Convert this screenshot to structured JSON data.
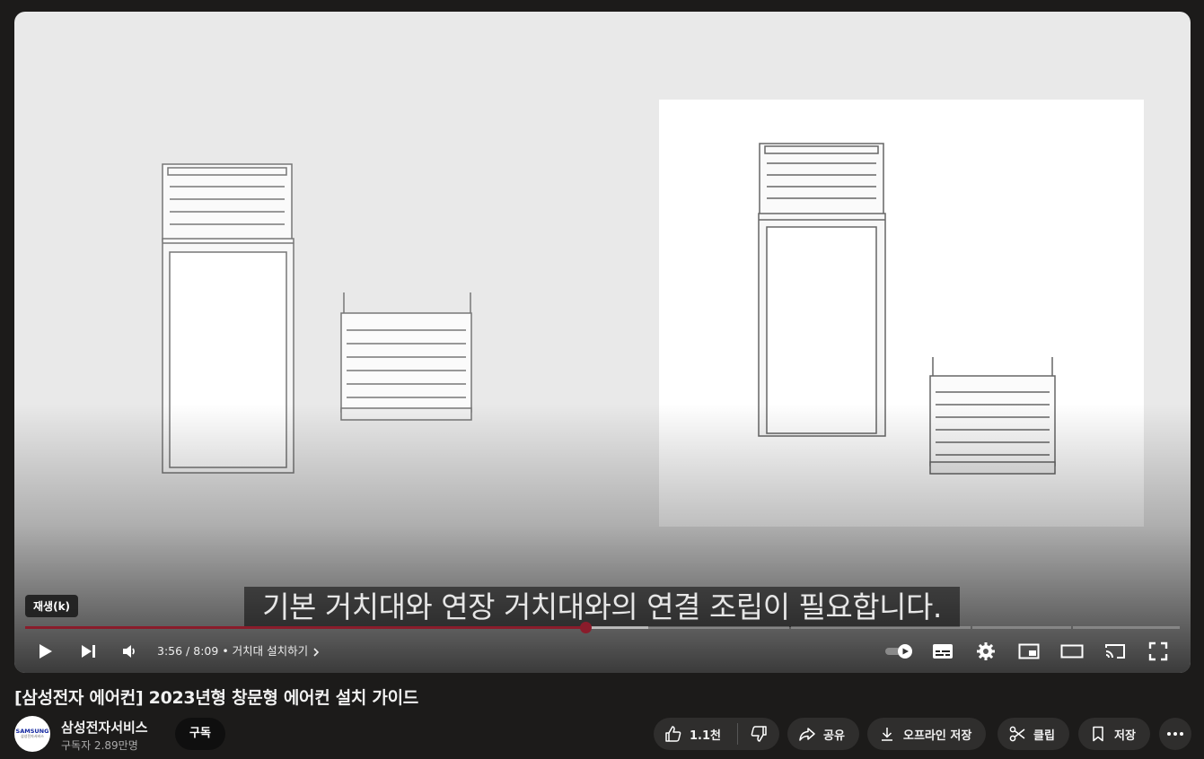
{
  "player": {
    "caption": "기본 거치대와 연장 거치대와의 연결 조립이 필요합니다.",
    "tooltip": "재생(k)",
    "progress": {
      "played_fraction": 0.485,
      "buffered_fraction": 0.54
    },
    "time_current": "3:56",
    "time_separator": " / ",
    "time_total": "8:09",
    "chapter": "• 거치대 설치하기",
    "icons": {
      "play": "play-icon",
      "next": "next-icon",
      "volume": "volume-icon",
      "autoplay": "autoplay-toggle-icon",
      "subtitles": "subtitles-icon",
      "settings": "gear-icon",
      "miniplayer": "miniplayer-icon",
      "theater": "theater-mode-icon",
      "cast": "cast-icon",
      "fullscreen": "fullscreen-icon"
    }
  },
  "video": {
    "title": "[삼성전자 에어컨] 2023년형 창문형 에어컨 설치 가이드"
  },
  "channel": {
    "avatar_text": "SAMSUNG",
    "avatar_subtext": "삼성전자서비스",
    "name": "삼성전자서비스",
    "subscribers": "구독자 2.89만명",
    "subscribe_label": "구독"
  },
  "actions": {
    "like_count": "1.1천",
    "share_label": "공유",
    "download_label": "오프라인 저장",
    "clip_label": "클립",
    "save_label": "저장"
  },
  "colors": {
    "accent": "#8a1c2b",
    "background": "#1c1b1a",
    "pill": "#2f2e2d"
  }
}
